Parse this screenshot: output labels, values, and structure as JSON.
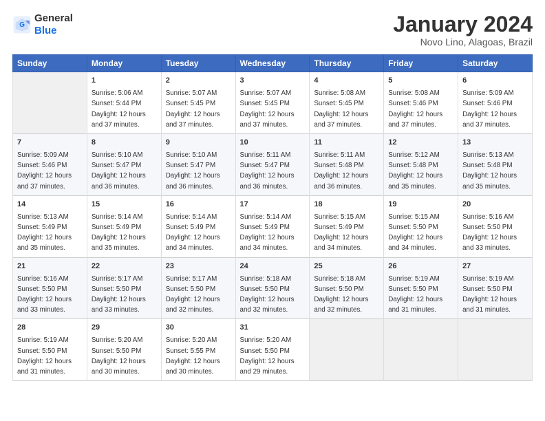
{
  "header": {
    "logo_line1": "General",
    "logo_line2": "Blue",
    "month": "January 2024",
    "location": "Novo Lino, Alagoas, Brazil"
  },
  "weekdays": [
    "Sunday",
    "Monday",
    "Tuesday",
    "Wednesday",
    "Thursday",
    "Friday",
    "Saturday"
  ],
  "weeks": [
    [
      {
        "day": "",
        "info": ""
      },
      {
        "day": "1",
        "info": "Sunrise: 5:06 AM\nSunset: 5:44 PM\nDaylight: 12 hours\nand 37 minutes."
      },
      {
        "day": "2",
        "info": "Sunrise: 5:07 AM\nSunset: 5:45 PM\nDaylight: 12 hours\nand 37 minutes."
      },
      {
        "day": "3",
        "info": "Sunrise: 5:07 AM\nSunset: 5:45 PM\nDaylight: 12 hours\nand 37 minutes."
      },
      {
        "day": "4",
        "info": "Sunrise: 5:08 AM\nSunset: 5:45 PM\nDaylight: 12 hours\nand 37 minutes."
      },
      {
        "day": "5",
        "info": "Sunrise: 5:08 AM\nSunset: 5:46 PM\nDaylight: 12 hours\nand 37 minutes."
      },
      {
        "day": "6",
        "info": "Sunrise: 5:09 AM\nSunset: 5:46 PM\nDaylight: 12 hours\nand 37 minutes."
      }
    ],
    [
      {
        "day": "7",
        "info": "Sunrise: 5:09 AM\nSunset: 5:46 PM\nDaylight: 12 hours\nand 37 minutes."
      },
      {
        "day": "8",
        "info": "Sunrise: 5:10 AM\nSunset: 5:47 PM\nDaylight: 12 hours\nand 36 minutes."
      },
      {
        "day": "9",
        "info": "Sunrise: 5:10 AM\nSunset: 5:47 PM\nDaylight: 12 hours\nand 36 minutes."
      },
      {
        "day": "10",
        "info": "Sunrise: 5:11 AM\nSunset: 5:47 PM\nDaylight: 12 hours\nand 36 minutes."
      },
      {
        "day": "11",
        "info": "Sunrise: 5:11 AM\nSunset: 5:48 PM\nDaylight: 12 hours\nand 36 minutes."
      },
      {
        "day": "12",
        "info": "Sunrise: 5:12 AM\nSunset: 5:48 PM\nDaylight: 12 hours\nand 35 minutes."
      },
      {
        "day": "13",
        "info": "Sunrise: 5:13 AM\nSunset: 5:48 PM\nDaylight: 12 hours\nand 35 minutes."
      }
    ],
    [
      {
        "day": "14",
        "info": "Sunrise: 5:13 AM\nSunset: 5:49 PM\nDaylight: 12 hours\nand 35 minutes."
      },
      {
        "day": "15",
        "info": "Sunrise: 5:14 AM\nSunset: 5:49 PM\nDaylight: 12 hours\nand 35 minutes."
      },
      {
        "day": "16",
        "info": "Sunrise: 5:14 AM\nSunset: 5:49 PM\nDaylight: 12 hours\nand 34 minutes."
      },
      {
        "day": "17",
        "info": "Sunrise: 5:14 AM\nSunset: 5:49 PM\nDaylight: 12 hours\nand 34 minutes."
      },
      {
        "day": "18",
        "info": "Sunrise: 5:15 AM\nSunset: 5:49 PM\nDaylight: 12 hours\nand 34 minutes."
      },
      {
        "day": "19",
        "info": "Sunrise: 5:15 AM\nSunset: 5:50 PM\nDaylight: 12 hours\nand 34 minutes."
      },
      {
        "day": "20",
        "info": "Sunrise: 5:16 AM\nSunset: 5:50 PM\nDaylight: 12 hours\nand 33 minutes."
      }
    ],
    [
      {
        "day": "21",
        "info": "Sunrise: 5:16 AM\nSunset: 5:50 PM\nDaylight: 12 hours\nand 33 minutes."
      },
      {
        "day": "22",
        "info": "Sunrise: 5:17 AM\nSunset: 5:50 PM\nDaylight: 12 hours\nand 33 minutes."
      },
      {
        "day": "23",
        "info": "Sunrise: 5:17 AM\nSunset: 5:50 PM\nDaylight: 12 hours\nand 32 minutes."
      },
      {
        "day": "24",
        "info": "Sunrise: 5:18 AM\nSunset: 5:50 PM\nDaylight: 12 hours\nand 32 minutes."
      },
      {
        "day": "25",
        "info": "Sunrise: 5:18 AM\nSunset: 5:50 PM\nDaylight: 12 hours\nand 32 minutes."
      },
      {
        "day": "26",
        "info": "Sunrise: 5:19 AM\nSunset: 5:50 PM\nDaylight: 12 hours\nand 31 minutes."
      },
      {
        "day": "27",
        "info": "Sunrise: 5:19 AM\nSunset: 5:50 PM\nDaylight: 12 hours\nand 31 minutes."
      }
    ],
    [
      {
        "day": "28",
        "info": "Sunrise: 5:19 AM\nSunset: 5:50 PM\nDaylight: 12 hours\nand 31 minutes."
      },
      {
        "day": "29",
        "info": "Sunrise: 5:20 AM\nSunset: 5:50 PM\nDaylight: 12 hours\nand 30 minutes."
      },
      {
        "day": "30",
        "info": "Sunrise: 5:20 AM\nSunset: 5:55 PM\nDaylight: 12 hours\nand 30 minutes."
      },
      {
        "day": "31",
        "info": "Sunrise: 5:20 AM\nSunset: 5:50 PM\nDaylight: 12 hours\nand 29 minutes."
      },
      {
        "day": "",
        "info": ""
      },
      {
        "day": "",
        "info": ""
      },
      {
        "day": "",
        "info": ""
      }
    ]
  ]
}
